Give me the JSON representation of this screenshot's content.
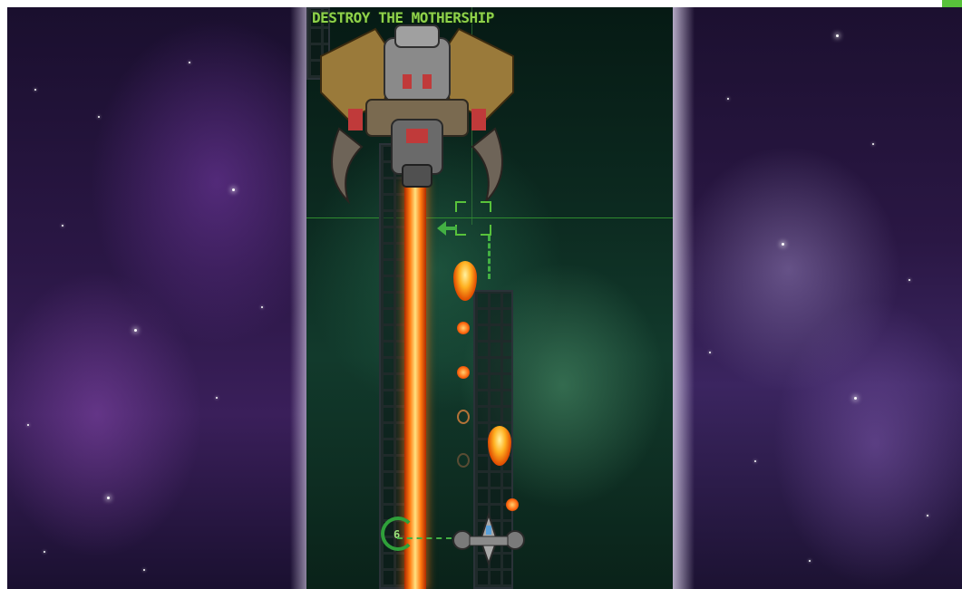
{
  "game": {
    "objective_text": "DESTROY THE MOTHERSHIP",
    "gauge_value": "6"
  },
  "colors": {
    "hud_green": "#8fd14a",
    "guide_green": "#43b043",
    "laser_core": "#ffe080",
    "laser_edge": "#ff7a10",
    "corner_tab": "#58c23b"
  },
  "icons": {
    "boss": "mothership-icon",
    "player": "player-ship-icon",
    "target": "target-reticle-icon",
    "direction": "arrow-left-icon",
    "gauge": "charge-gauge-icon"
  }
}
